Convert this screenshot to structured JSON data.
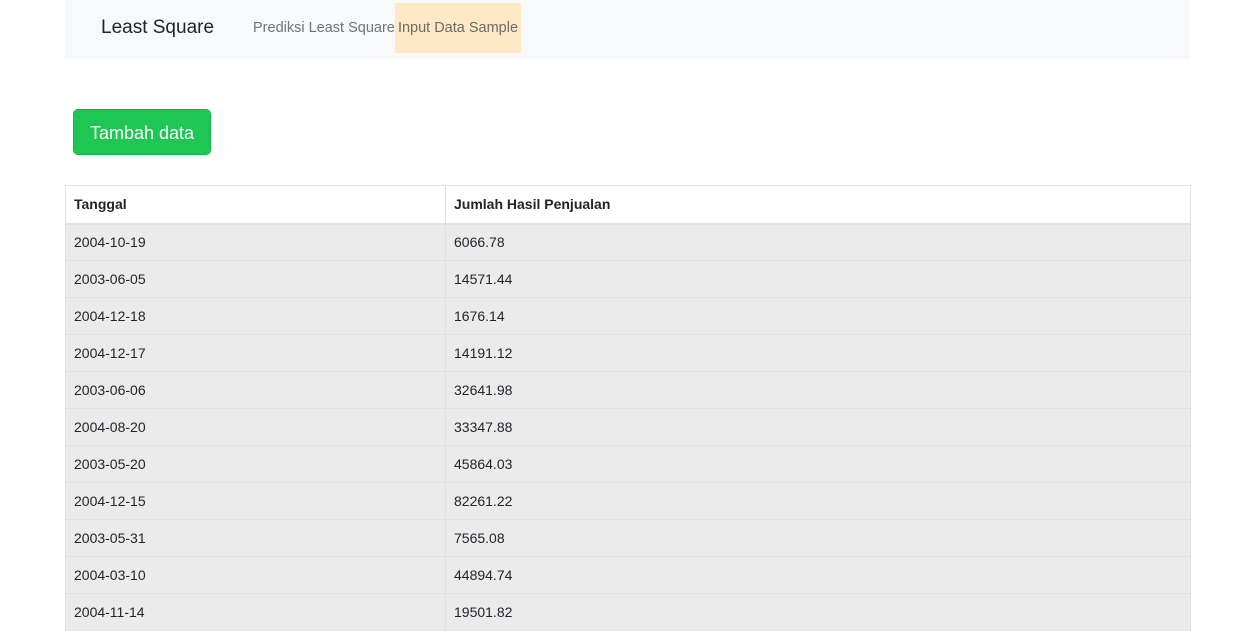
{
  "navbar": {
    "brand": "Least Square",
    "links": [
      {
        "label": "Prediksi Least Square",
        "active": false
      },
      {
        "label": "Input Data Sample",
        "active": true
      }
    ]
  },
  "actions": {
    "add_label": "Tambah data"
  },
  "table": {
    "headers": [
      "Tanggal",
      "Jumlah Hasil Penjualan"
    ],
    "rows": [
      [
        "2004-10-19",
        "6066.78"
      ],
      [
        "2003-06-05",
        "14571.44"
      ],
      [
        "2004-12-18",
        "1676.14"
      ],
      [
        "2004-12-17",
        "14191.12"
      ],
      [
        "2003-06-06",
        "32641.98"
      ],
      [
        "2004-08-20",
        "33347.88"
      ],
      [
        "2003-05-20",
        "45864.03"
      ],
      [
        "2004-12-15",
        "82261.22"
      ],
      [
        "2003-05-31",
        "7565.08"
      ],
      [
        "2004-03-10",
        "44894.74"
      ],
      [
        "2004-11-14",
        "19501.82"
      ]
    ]
  },
  "colors": {
    "success": "#1fc653",
    "active_tab_bg": "#ffe8c6",
    "navbar_bg": "#f8f9fa",
    "row_bg": "#ebebeb"
  }
}
